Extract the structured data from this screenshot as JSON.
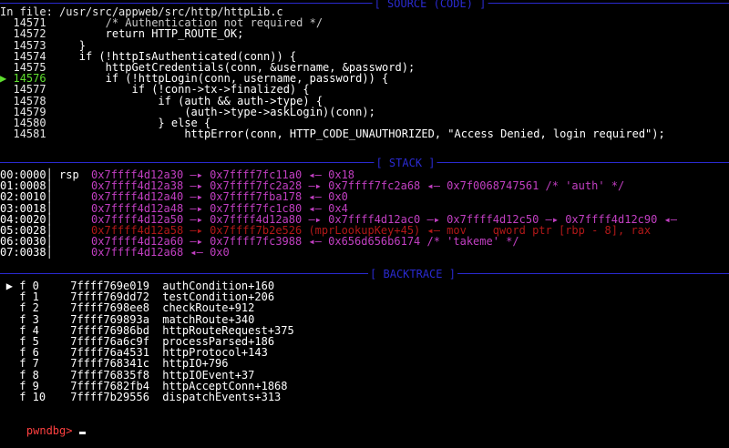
{
  "source": {
    "section_title": "[ SOURCE (CODE) ]",
    "file_label": "In file: /usr/src/appweb/src/http/httpLib.c",
    "current_marker": "▶",
    "lines": [
      {
        "no": "14571",
        "code": "        /* Authentication not required */"
      },
      {
        "no": "14572",
        "code": "        return HTTP_ROUTE_OK;"
      },
      {
        "no": "14573",
        "code": "    }"
      },
      {
        "no": "14574",
        "code": "    if (!httpIsAuthenticated(conn)) {"
      },
      {
        "no": "14575",
        "code": "        httpGetCredentials(conn, &username, &password);"
      },
      {
        "no": "14576",
        "code": "        if (!httpLogin(conn, username, password)) {"
      },
      {
        "no": "14577",
        "code": "            if (!conn->tx->finalized) {"
      },
      {
        "no": "14578",
        "code": "                if (auth && auth->type) {"
      },
      {
        "no": "14579",
        "code": "                    (auth->type->askLogin)(conn);"
      },
      {
        "no": "14580",
        "code": "                } else {"
      },
      {
        "no": "14581",
        "code": "                    httpError(conn, HTTP_CODE_UNAUTHORIZED, \"Access Denied, login required\");"
      }
    ]
  },
  "stack": {
    "section_title": "[ STACK ]",
    "rows": [
      {
        "off": "00:0000",
        "reg": "rsp",
        "chain": "0x7ffff4d12a30 —▸ 0x7ffff7fc11a0 ◂— 0x18"
      },
      {
        "off": "01:0008",
        "reg": "",
        "chain": "0x7ffff4d12a38 —▸ 0x7ffff7fc2a28 —▸ 0x7ffff7fc2a68 ◂— 0x7f0068747561 /* 'auth' */"
      },
      {
        "off": "02:0010",
        "reg": "",
        "chain": "0x7ffff4d12a40 —▸ 0x7ffff7fba178 ◂— 0x0"
      },
      {
        "off": "03:0018",
        "reg": "",
        "chain": "0x7ffff4d12a48 —▸ 0x7ffff7fc1c80 ◂— 0x4"
      },
      {
        "off": "04:0020",
        "reg": "",
        "chain": "0x7ffff4d12a50 —▸ 0x7ffff4d12a80 —▸ 0x7ffff4d12ac0 —▸ 0x7ffff4d12c50 —▸ 0x7ffff4d12c90 ◂—"
      },
      {
        "off": "05:0028",
        "reg": "",
        "chain": "0x7ffff4d12a58 —▸ 0x7ffff7b2e526 (mprLookupKey+45) ◂— mov    qword ptr [rbp - 8], rax"
      },
      {
        "off": "06:0030",
        "reg": "",
        "chain": "0x7ffff4d12a60 —▸ 0x7ffff7fc3988 ◂— 0x656d656b6174 /* 'takeme' */"
      },
      {
        "off": "07:0038",
        "reg": "",
        "chain": "0x7ffff4d12a68 ◂— 0x0"
      }
    ]
  },
  "backtrace": {
    "section_title": "[ BACKTRACE ]",
    "current_marker": "▶",
    "frames": [
      {
        "frame": "f 0",
        "addr": "7ffff769e019",
        "sym": "authCondition+160"
      },
      {
        "frame": "f 1",
        "addr": "7ffff769dd72",
        "sym": "testCondition+206"
      },
      {
        "frame": "f 2",
        "addr": "7ffff7698ee8",
        "sym": "checkRoute+912"
      },
      {
        "frame": "f 3",
        "addr": "7ffff769893a",
        "sym": "matchRoute+340"
      },
      {
        "frame": "f 4",
        "addr": "7ffff76986bd",
        "sym": "httpRouteRequest+375"
      },
      {
        "frame": "f 5",
        "addr": "7ffff76a6c9f",
        "sym": "processParsed+186"
      },
      {
        "frame": "f 6",
        "addr": "7ffff76a4531",
        "sym": "httpProtocol+143"
      },
      {
        "frame": "f 7",
        "addr": "7ffff768341c",
        "sym": "httpIO+796"
      },
      {
        "frame": "f 8",
        "addr": "7ffff76835f8",
        "sym": "httpIOEvent+37"
      },
      {
        "frame": "f 9",
        "addr": "7ffff7682fb4",
        "sym": "httpAcceptConn+1868"
      },
      {
        "frame": "f 10",
        "addr": "7ffff7b29556",
        "sym": "dispatchEvents+313"
      }
    ]
  },
  "prompt": {
    "text": "pwndbg>",
    "input": ""
  },
  "colors": {
    "separator": "#2a2ad0",
    "stack_addr": "#c23fc2",
    "code_addr": "#b21818",
    "current_line": "#5fdf2f",
    "prompt": "#ff4040"
  }
}
